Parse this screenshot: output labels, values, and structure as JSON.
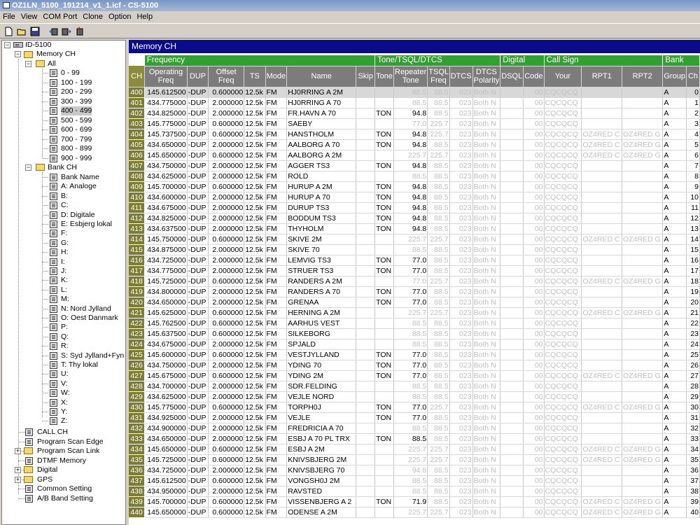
{
  "window": {
    "title": "OZ1LN_5100_191214_v1_1.icf - CS-5100"
  },
  "menu": [
    "File",
    "View",
    "COM Port",
    "Clone",
    "Option",
    "Help"
  ],
  "tree": {
    "root": "ID-5100",
    "memory_ch": "Memory CH",
    "all": "All",
    "ranges": [
      "0 - 99",
      "100 - 199",
      "200 - 299",
      "300 - 399",
      "400 - 499",
      "500 - 599",
      "600 - 699",
      "700 - 799",
      "800 - 899",
      "900 - 999"
    ],
    "bank_ch": "Bank CH",
    "banks": [
      "Bank Name",
      "A: Analoge",
      "B:",
      "C:",
      "D: Digitale",
      "E: Esbjerg lokal",
      "F:",
      "G:",
      "H:",
      "I:",
      "J:",
      "K:",
      "L:",
      "M:",
      "N: Nord Jylland",
      "O: Oest Danmark",
      "P:",
      "Q:",
      "R:",
      "S: Syd Jylland+Fyn",
      "T: Thy lokal",
      "U:",
      "V:",
      "W:",
      "X:",
      "Y:",
      "Z:"
    ],
    "others": [
      "CALL CH",
      "Program Scan Edge",
      "Program Scan Link",
      "DTMF Memory",
      "Digital",
      "GPS",
      "Common Setting",
      "A/B Band Setting"
    ]
  },
  "panel": {
    "title": "Memory CH"
  },
  "groups": {
    "frequency": "Frequency",
    "tone": "Tone/TSQL/DTCS",
    "digital": "Digital",
    "callsign": "Call Sign",
    "bank": "Bank"
  },
  "columns": [
    "CH",
    "Operating Freq",
    "DUP",
    "Offset Freq",
    "TS",
    "Mode",
    "Name",
    "Skip",
    "Tone",
    "Repeater Tone",
    "TSQL Freq",
    "DTCS",
    "DTCS Polarity",
    "DSQL",
    "Code",
    "Your",
    "RPT1",
    "RPT2",
    "Group",
    "Ch"
  ],
  "rows": [
    [
      "400",
      "145.612500",
      "-DUP",
      "0.600000",
      "12.5k",
      "FM",
      "HJ0RRING A 2M",
      "",
      "",
      "88.5",
      "88.5",
      "023",
      "Both N",
      "",
      "00",
      "CQCQCQ",
      "",
      "",
      "A",
      "0"
    ],
    [
      "401",
      "434.775000",
      "-DUP",
      "2.000000",
      "12.5k",
      "FM",
      "HJ0RRING A 70",
      "",
      "",
      "88.5",
      "88.5",
      "023",
      "Both N",
      "",
      "00",
      "CQCQCQ",
      "",
      "",
      "A",
      "1"
    ],
    [
      "402",
      "434.825000",
      "-DUP",
      "2.000000",
      "12.5k",
      "FM",
      "FR.HAVN A 70",
      "",
      "TON",
      "94.8",
      "88.5",
      "023",
      "Both N",
      "",
      "00",
      "CQCQCQ",
      "",
      "",
      "A",
      "2"
    ],
    [
      "403",
      "145.775000",
      "-DUP",
      "0.600000",
      "12.5k",
      "FM",
      "SAEBY",
      "",
      "",
      "77.0",
      "225.7",
      "023",
      "Both N",
      "",
      "00",
      "CQCQCQ",
      "",
      "",
      "A",
      "3"
    ],
    [
      "404",
      "145.737500",
      "-DUP",
      "0.600000",
      "12.5k",
      "FM",
      "HANSTHOLM",
      "",
      "TON",
      "94.8",
      "225.7",
      "023",
      "Both N",
      "",
      "00",
      "CQCQCQ",
      "OZ4RED C",
      "OZ4RED G",
      "A",
      "4"
    ],
    [
      "405",
      "434.650000",
      "-DUP",
      "2.000000",
      "12.5k",
      "FM",
      "AALBORG A 70",
      "",
      "TON",
      "94.8",
      "88.5",
      "023",
      "Both N",
      "",
      "00",
      "CQCQCQ",
      "OZ4RED C",
      "OZ4RED G",
      "A",
      "5"
    ],
    [
      "406",
      "145.650000",
      "-DUP",
      "0.600000",
      "12.5k",
      "FM",
      "AALBORG A 2M",
      "",
      "",
      "225.7",
      "225.7",
      "023",
      "Both N",
      "",
      "00",
      "CQCQCQ",
      "OZ4RED C",
      "OZ4RED G",
      "A",
      "6"
    ],
    [
      "407",
      "434.750000",
      "-DUP",
      "2.000000",
      "12.5k",
      "FM",
      "AGGER TS3",
      "",
      "TON",
      "94.8",
      "88.5",
      "023",
      "Both N",
      "",
      "00",
      "CQCQCQ",
      "",
      "",
      "A",
      "7"
    ],
    [
      "408",
      "434.625000",
      "-DUP",
      "2.000000",
      "12.5k",
      "FM",
      "ROLD",
      "",
      "",
      "88.5",
      "88.5",
      "023",
      "Both N",
      "",
      "00",
      "CQCQCQ",
      "",
      "",
      "A",
      "8"
    ],
    [
      "409",
      "145.700000",
      "-DUP",
      "0.600000",
      "12.5k",
      "FM",
      "HURUP A 2M",
      "",
      "TON",
      "94.8",
      "88.5",
      "023",
      "Both N",
      "",
      "00",
      "CQCQCQ",
      "",
      "",
      "A",
      "9"
    ],
    [
      "410",
      "434.600000",
      "-DUP",
      "2.000000",
      "12.5k",
      "FM",
      "HURUP A 70",
      "",
      "TON",
      "94.8",
      "88.5",
      "023",
      "Both N",
      "",
      "00",
      "CQCQCQ",
      "",
      "",
      "A",
      "10"
    ],
    [
      "411",
      "434.675000",
      "-DUP",
      "2.000000",
      "12.5k",
      "FM",
      "DURUP TS3",
      "",
      "TON",
      "94.8",
      "88.5",
      "023",
      "Both N",
      "",
      "00",
      "CQCQCQ",
      "",
      "",
      "A",
      "11"
    ],
    [
      "412",
      "434.825000",
      "-DUP",
      "2.000000",
      "12.5k",
      "FM",
      "BODDUM TS3",
      "",
      "TON",
      "94.8",
      "88.5",
      "023",
      "Both N",
      "",
      "00",
      "CQCQCQ",
      "",
      "",
      "A",
      "12"
    ],
    [
      "413",
      "434.637500",
      "-DUP",
      "2.000000",
      "12.5k",
      "FM",
      "THYHOLM",
      "",
      "TON",
      "94.8",
      "88.5",
      "023",
      "Both N",
      "",
      "00",
      "CQCQCQ",
      "",
      "",
      "A",
      "13"
    ],
    [
      "414",
      "145.750000",
      "-DUP",
      "0.600000",
      "12.5k",
      "FM",
      "SKIVE 2M",
      "",
      "",
      "225.7",
      "225.7",
      "023",
      "Both N",
      "",
      "00",
      "CQCQCQ",
      "OZ4RED C",
      "OZ4RED G",
      "A",
      "14"
    ],
    [
      "415",
      "434.875000",
      "-DUP",
      "2.000000",
      "12.5k",
      "FM",
      "SKIVE 70",
      "",
      "",
      "88.5",
      "88.5",
      "023",
      "Both N",
      "",
      "00",
      "CQCQCQ",
      "",
      "",
      "A",
      "15"
    ],
    [
      "416",
      "434.725000",
      "-DUP",
      "2.000000",
      "12.5k",
      "FM",
      "LEMVIG TS3",
      "",
      "TON",
      "77.0",
      "88.5",
      "023",
      "Both N",
      "",
      "00",
      "CQCQCQ",
      "",
      "",
      "A",
      "16"
    ],
    [
      "417",
      "434.775000",
      "-DUP",
      "2.000000",
      "12.5k",
      "FM",
      "STRUER TS3",
      "",
      "TON",
      "77.0",
      "88.5",
      "023",
      "Both N",
      "",
      "00",
      "CQCQCQ",
      "",
      "",
      "A",
      "17"
    ],
    [
      "418",
      "145.725000",
      "-DUP",
      "0.600000",
      "12.5k",
      "FM",
      "RANDERS A 2M",
      "",
      "",
      "77.0",
      "225.7",
      "023",
      "Both N",
      "",
      "00",
      "CQCQCQ",
      "OZ4RED C",
      "OZ4RED G",
      "A",
      "18"
    ],
    [
      "419",
      "434.800000",
      "-DUP",
      "2.000000",
      "12.5k",
      "FM",
      "RANDERS A 70",
      "",
      "TON",
      "77.0",
      "88.5",
      "023",
      "Both N",
      "",
      "00",
      "CQCQCQ",
      "",
      "",
      "A",
      "19"
    ],
    [
      "420",
      "434.650000",
      "-DUP",
      "2.000000",
      "12.5k",
      "FM",
      "GRENAA",
      "",
      "TON",
      "77.0",
      "88.5",
      "023",
      "Both N",
      "",
      "00",
      "CQCQCQ",
      "",
      "",
      "A",
      "20"
    ],
    [
      "421",
      "145.625000",
      "-DUP",
      "0.600000",
      "12.5k",
      "FM",
      "HERNING A 2M",
      "",
      "",
      "225.7",
      "225.7",
      "023",
      "Both N",
      "",
      "00",
      "CQCQCQ",
      "OZ4RED C",
      "OZ4RED G",
      "A",
      "21"
    ],
    [
      "422",
      "145.762500",
      "-DUP",
      "0.600000",
      "12.5k",
      "FM",
      "AARHUS VEST",
      "",
      "",
      "88.5",
      "88.5",
      "023",
      "Both N",
      "",
      "00",
      "CQCQCQ",
      "",
      "",
      "A",
      "22"
    ],
    [
      "423",
      "145.637500",
      "-DUP",
      "0.600000",
      "12.5k",
      "FM",
      "SILKEBORG",
      "",
      "",
      "88.5",
      "88.5",
      "023",
      "Both N",
      "",
      "00",
      "CQCQCQ",
      "",
      "",
      "A",
      "23"
    ],
    [
      "424",
      "434.675000",
      "-DUP",
      "2.000000",
      "12.5k",
      "FM",
      "SPJALD",
      "",
      "",
      "88.5",
      "88.5",
      "023",
      "Both N",
      "",
      "00",
      "CQCQCQ",
      "",
      "",
      "A",
      "24"
    ],
    [
      "425",
      "145.600000",
      "-DUP",
      "0.600000",
      "12.5k",
      "FM",
      "VESTJYLLAND",
      "",
      "TON",
      "77.0",
      "88.5",
      "023",
      "Both N",
      "",
      "00",
      "CQCQCQ",
      "",
      "",
      "A",
      "25"
    ],
    [
      "426",
      "434.750000",
      "-DUP",
      "2.000000",
      "12.5k",
      "FM",
      "YDING 70",
      "",
      "TON",
      "77.0",
      "88.5",
      "023",
      "Both N",
      "",
      "00",
      "CQCQCQ",
      "",
      "",
      "A",
      "26"
    ],
    [
      "427",
      "145.675000",
      "-DUP",
      "0.600000",
      "12.5k",
      "FM",
      "YDING 2M",
      "",
      "TON",
      "77.0",
      "88.5",
      "023",
      "Both N",
      "",
      "00",
      "CQCQCQ",
      "OZ4RED C",
      "OZ4RED G",
      "A",
      "27"
    ],
    [
      "428",
      "434.700000",
      "-DUP",
      "2.000000",
      "12.5k",
      "FM",
      "SDR.FELDING",
      "",
      "",
      "88.5",
      "88.5",
      "023",
      "Both N",
      "",
      "00",
      "CQCQCQ",
      "",
      "",
      "A",
      "28"
    ],
    [
      "429",
      "434.625000",
      "-DUP",
      "2.000000",
      "12.5k",
      "FM",
      "VEJLE NORD",
      "",
      "",
      "88.5",
      "88.5",
      "023",
      "Both N",
      "",
      "00",
      "CQCQCQ",
      "",
      "",
      "A",
      "29"
    ],
    [
      "430",
      "145.775000",
      "-DUP",
      "0.600000",
      "12.5k",
      "FM",
      "TORPH0J",
      "",
      "TON",
      "77.0",
      "225.7",
      "023",
      "Both N",
      "",
      "00",
      "CQCQCQ",
      "OZ4RED C",
      "OZ4RED G",
      "A",
      "30"
    ],
    [
      "431",
      "434.925000",
      "-DUP",
      "2.000000",
      "12.5k",
      "FM",
      "VEJLE",
      "",
      "TON",
      "77.0",
      "88.5",
      "023",
      "Both N",
      "",
      "00",
      "CQCQCQ",
      "",
      "",
      "A",
      "31"
    ],
    [
      "432",
      "434.900000",
      "-DUP",
      "2.000000",
      "12.5k",
      "FM",
      "FREDRICIA A 70",
      "",
      "",
      "88.5",
      "88.5",
      "023",
      "Both N",
      "",
      "00",
      "CQCQCQ",
      "",
      "",
      "A",
      "32"
    ],
    [
      "433",
      "434.650000",
      "-DUP",
      "2.000000",
      "12.5k",
      "FM",
      "ESBJ A 70 PL TRX",
      "",
      "TON",
      "88.5",
      "88.5",
      "023",
      "Both N",
      "",
      "00",
      "CQCQCQ",
      "",
      "",
      "A",
      "33"
    ],
    [
      "434",
      "145.650000",
      "-DUP",
      "0.600000",
      "12.5k",
      "FM",
      "ESBJ A 2M",
      "",
      "",
      "225.7",
      "225.7",
      "023",
      "Both N",
      "",
      "00",
      "CQCQCQ",
      "OZ4RED C",
      "OZ4RED G",
      "A",
      "34"
    ],
    [
      "435",
      "145.725000",
      "-DUP",
      "0.600000",
      "12.5k",
      "FM",
      "KNIVSBJERG 2M",
      "",
      "",
      "225.7",
      "225.7",
      "023",
      "Both N",
      "",
      "00",
      "CQCQCQ",
      "OZ4RED C",
      "OZ4RED G",
      "A",
      "35"
    ],
    [
      "436",
      "434.725000",
      "-DUP",
      "2.000000",
      "12.5k",
      "FM",
      "KNIVSBJERG 70",
      "",
      "",
      "94.8",
      "88.5",
      "023",
      "Both N",
      "",
      "00",
      "CQCQCQ",
      "",
      "",
      "A",
      "36"
    ],
    [
      "437",
      "145.612500",
      "-DUP",
      "0.600000",
      "12.5k",
      "FM",
      "VONGSH0J 2M",
      "",
      "",
      "88.5",
      "88.5",
      "023",
      "Both N",
      "",
      "00",
      "CQCQCQ",
      "",
      "",
      "A",
      "37"
    ],
    [
      "438",
      "434.950000",
      "-DUP",
      "2.000000",
      "12.5k",
      "FM",
      "RAVSTED",
      "",
      "",
      "88.5",
      "88.5",
      "023",
      "Both N",
      "",
      "00",
      "CQCQCQ",
      "",
      "",
      "A",
      "38"
    ],
    [
      "439",
      "145.700000",
      "-DUP",
      "0.600000",
      "12.5k",
      "FM",
      "VISSENBJERG A 2",
      "",
      "TON",
      "71.9",
      "88.5",
      "023",
      "Both N",
      "",
      "00",
      "CQCQCQ",
      "OZ4RED C",
      "OZ4RED G",
      "A",
      "39"
    ],
    [
      "440",
      "145.650000",
      "-DUP",
      "0.600000",
      "12.5k",
      "FM",
      "ODENSE A 2M",
      "",
      "",
      "225.7",
      "225.7",
      "023",
      "Both N",
      "",
      "00",
      "CQCQCQ",
      "OZ4RED C",
      "OZ4RED G",
      "A",
      "40"
    ]
  ]
}
